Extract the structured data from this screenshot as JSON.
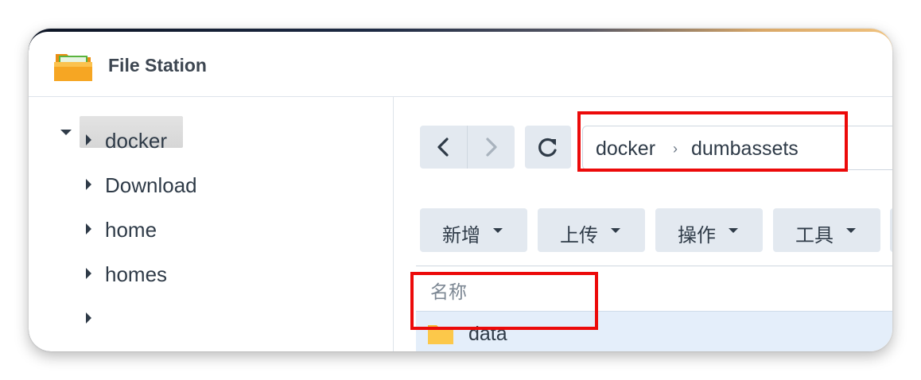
{
  "app": {
    "title": "File Station",
    "icon": "file-station-folder-icon"
  },
  "sidebar": {
    "root_label": "",
    "items": [
      {
        "label": "docker"
      },
      {
        "label": "Download"
      },
      {
        "label": "home"
      },
      {
        "label": "homes"
      }
    ]
  },
  "toolbar": {
    "back_icon": "chevron-left-icon",
    "forward_icon": "chevron-right-icon",
    "refresh_icon": "refresh-icon",
    "path": [
      "docker",
      "dumbassets"
    ],
    "path_separator": "›",
    "buttons": [
      {
        "label": "新增"
      },
      {
        "label": "上传"
      },
      {
        "label": "操作"
      },
      {
        "label": "工具"
      }
    ]
  },
  "file_list": {
    "columns": [
      "名称"
    ],
    "rows": [
      {
        "name": "data",
        "type": "folder",
        "selected": true
      }
    ]
  },
  "colors": {
    "highlight": "#ec0a0a",
    "selection": "#e4eefa",
    "button_bg": "#e3e9f0"
  }
}
